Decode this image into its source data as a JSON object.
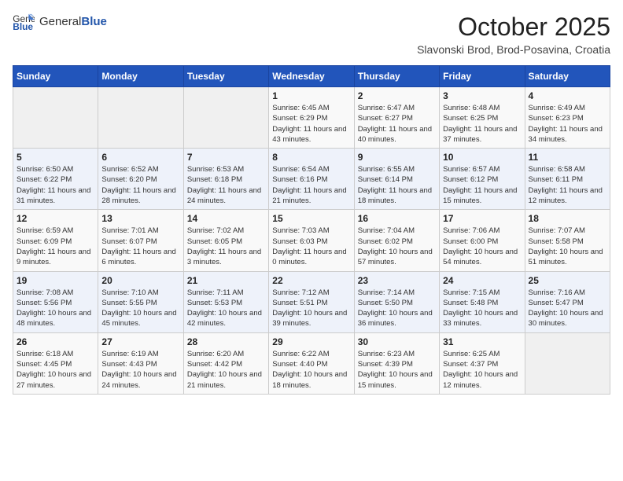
{
  "header": {
    "logo": {
      "general": "General",
      "blue": "Blue"
    },
    "title": "October 2025",
    "location": "Slavonski Brod, Brod-Posavina, Croatia"
  },
  "calendar": {
    "days_of_week": [
      "Sunday",
      "Monday",
      "Tuesday",
      "Wednesday",
      "Thursday",
      "Friday",
      "Saturday"
    ],
    "weeks": [
      [
        {
          "day": "",
          "info": ""
        },
        {
          "day": "",
          "info": ""
        },
        {
          "day": "",
          "info": ""
        },
        {
          "day": "1",
          "info": "Sunrise: 6:45 AM\nSunset: 6:29 PM\nDaylight: 11 hours and 43 minutes."
        },
        {
          "day": "2",
          "info": "Sunrise: 6:47 AM\nSunset: 6:27 PM\nDaylight: 11 hours and 40 minutes."
        },
        {
          "day": "3",
          "info": "Sunrise: 6:48 AM\nSunset: 6:25 PM\nDaylight: 11 hours and 37 minutes."
        },
        {
          "day": "4",
          "info": "Sunrise: 6:49 AM\nSunset: 6:23 PM\nDaylight: 11 hours and 34 minutes."
        }
      ],
      [
        {
          "day": "5",
          "info": "Sunrise: 6:50 AM\nSunset: 6:22 PM\nDaylight: 11 hours and 31 minutes."
        },
        {
          "day": "6",
          "info": "Sunrise: 6:52 AM\nSunset: 6:20 PM\nDaylight: 11 hours and 28 minutes."
        },
        {
          "day": "7",
          "info": "Sunrise: 6:53 AM\nSunset: 6:18 PM\nDaylight: 11 hours and 24 minutes."
        },
        {
          "day": "8",
          "info": "Sunrise: 6:54 AM\nSunset: 6:16 PM\nDaylight: 11 hours and 21 minutes."
        },
        {
          "day": "9",
          "info": "Sunrise: 6:55 AM\nSunset: 6:14 PM\nDaylight: 11 hours and 18 minutes."
        },
        {
          "day": "10",
          "info": "Sunrise: 6:57 AM\nSunset: 6:12 PM\nDaylight: 11 hours and 15 minutes."
        },
        {
          "day": "11",
          "info": "Sunrise: 6:58 AM\nSunset: 6:11 PM\nDaylight: 11 hours and 12 minutes."
        }
      ],
      [
        {
          "day": "12",
          "info": "Sunrise: 6:59 AM\nSunset: 6:09 PM\nDaylight: 11 hours and 9 minutes."
        },
        {
          "day": "13",
          "info": "Sunrise: 7:01 AM\nSunset: 6:07 PM\nDaylight: 11 hours and 6 minutes."
        },
        {
          "day": "14",
          "info": "Sunrise: 7:02 AM\nSunset: 6:05 PM\nDaylight: 11 hours and 3 minutes."
        },
        {
          "day": "15",
          "info": "Sunrise: 7:03 AM\nSunset: 6:03 PM\nDaylight: 11 hours and 0 minutes."
        },
        {
          "day": "16",
          "info": "Sunrise: 7:04 AM\nSunset: 6:02 PM\nDaylight: 10 hours and 57 minutes."
        },
        {
          "day": "17",
          "info": "Sunrise: 7:06 AM\nSunset: 6:00 PM\nDaylight: 10 hours and 54 minutes."
        },
        {
          "day": "18",
          "info": "Sunrise: 7:07 AM\nSunset: 5:58 PM\nDaylight: 10 hours and 51 minutes."
        }
      ],
      [
        {
          "day": "19",
          "info": "Sunrise: 7:08 AM\nSunset: 5:56 PM\nDaylight: 10 hours and 48 minutes."
        },
        {
          "day": "20",
          "info": "Sunrise: 7:10 AM\nSunset: 5:55 PM\nDaylight: 10 hours and 45 minutes."
        },
        {
          "day": "21",
          "info": "Sunrise: 7:11 AM\nSunset: 5:53 PM\nDaylight: 10 hours and 42 minutes."
        },
        {
          "day": "22",
          "info": "Sunrise: 7:12 AM\nSunset: 5:51 PM\nDaylight: 10 hours and 39 minutes."
        },
        {
          "day": "23",
          "info": "Sunrise: 7:14 AM\nSunset: 5:50 PM\nDaylight: 10 hours and 36 minutes."
        },
        {
          "day": "24",
          "info": "Sunrise: 7:15 AM\nSunset: 5:48 PM\nDaylight: 10 hours and 33 minutes."
        },
        {
          "day": "25",
          "info": "Sunrise: 7:16 AM\nSunset: 5:47 PM\nDaylight: 10 hours and 30 minutes."
        }
      ],
      [
        {
          "day": "26",
          "info": "Sunrise: 6:18 AM\nSunset: 4:45 PM\nDaylight: 10 hours and 27 minutes."
        },
        {
          "day": "27",
          "info": "Sunrise: 6:19 AM\nSunset: 4:43 PM\nDaylight: 10 hours and 24 minutes."
        },
        {
          "day": "28",
          "info": "Sunrise: 6:20 AM\nSunset: 4:42 PM\nDaylight: 10 hours and 21 minutes."
        },
        {
          "day": "29",
          "info": "Sunrise: 6:22 AM\nSunset: 4:40 PM\nDaylight: 10 hours and 18 minutes."
        },
        {
          "day": "30",
          "info": "Sunrise: 6:23 AM\nSunset: 4:39 PM\nDaylight: 10 hours and 15 minutes."
        },
        {
          "day": "31",
          "info": "Sunrise: 6:25 AM\nSunset: 4:37 PM\nDaylight: 10 hours and 12 minutes."
        },
        {
          "day": "",
          "info": ""
        }
      ]
    ]
  }
}
